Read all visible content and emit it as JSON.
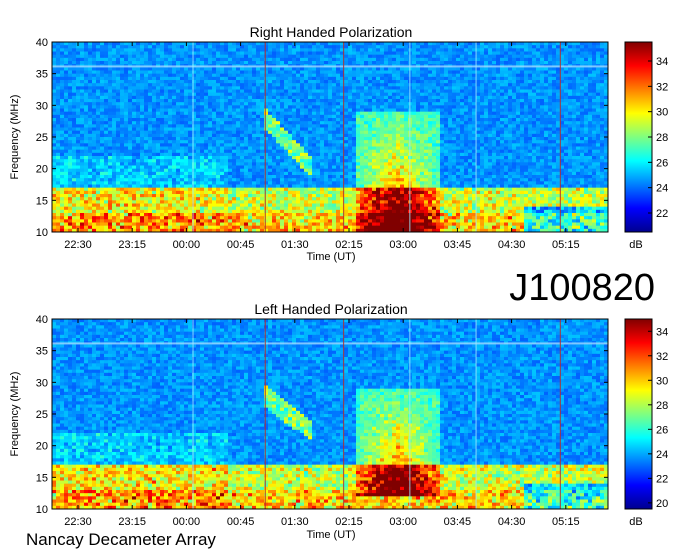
{
  "figure": {
    "id_label": "J100820",
    "footer": "Nancay Decameter Array"
  },
  "chart_data": [
    {
      "type": "heatmap",
      "title": "Right Handed Polarization",
      "xlabel": "Time (UT)",
      "ylabel": "Frequency (MHz)",
      "x_ticks": [
        "22:30",
        "23:15",
        "00:00",
        "00:45",
        "01:30",
        "02:15",
        "03:00",
        "03:45",
        "04:30",
        "05:15"
      ],
      "y_ticks": [
        10,
        15,
        20,
        25,
        30,
        35,
        40
      ],
      "ylim": [
        10,
        40
      ],
      "colorbar": {
        "label": "dB",
        "ticks": [
          22,
          24,
          26,
          28,
          30,
          32,
          34
        ],
        "range": [
          20.5,
          35.5
        ]
      },
      "features": {
        "burst": {
          "t_start": "02:20",
          "t_end": "03:30",
          "f_min": 10,
          "f_max": 29
        },
        "drifting_emission": {
          "t_start": "01:05",
          "t_end": "01:45",
          "f_start": 28,
          "f_end": 20
        }
      }
    },
    {
      "type": "heatmap",
      "title": "Left Handed Polarization",
      "xlabel": "Time (UT)",
      "ylabel": "Frequency (MHz)",
      "x_ticks": [
        "22:30",
        "23:15",
        "00:00",
        "00:45",
        "01:30",
        "02:15",
        "03:00",
        "03:45",
        "04:30",
        "05:15"
      ],
      "y_ticks": [
        10,
        15,
        20,
        25,
        30,
        35,
        40
      ],
      "ylim": [
        10,
        40
      ],
      "colorbar": {
        "label": "dB",
        "ticks": [
          20,
          22,
          24,
          26,
          28,
          30,
          32,
          34
        ],
        "range": [
          19.5,
          35
        ]
      },
      "features": {
        "burst": {
          "t_start": "02:20",
          "t_end": "03:30",
          "f_min": 12,
          "f_max": 29
        },
        "drifting_emission": {
          "t_start": "01:05",
          "t_end": "01:45",
          "f_start": 28,
          "f_end": 22
        }
      }
    }
  ]
}
